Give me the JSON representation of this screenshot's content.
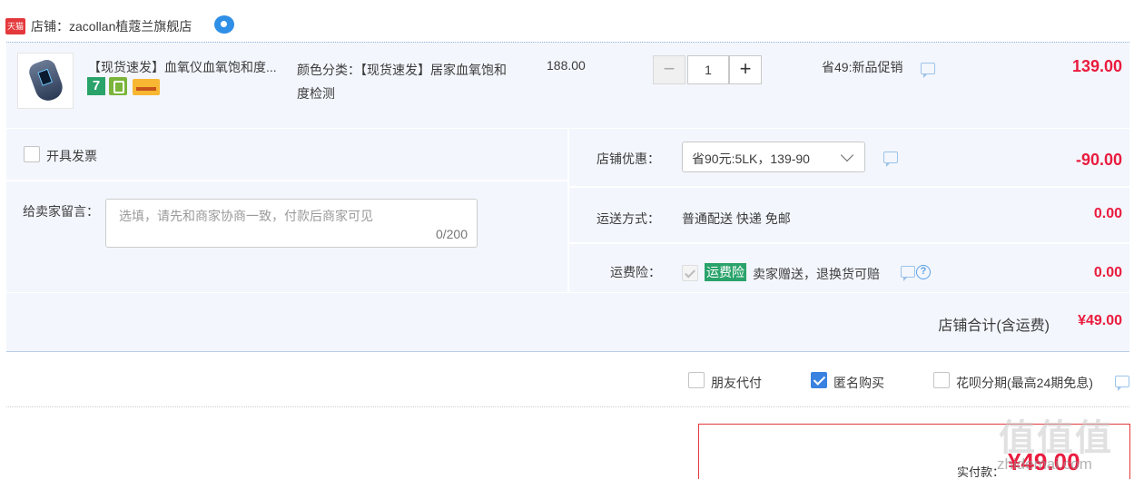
{
  "shop": {
    "logo_text": "天猫",
    "name": "店铺：zacollan植蔻兰旗舰店",
    "chat_icon": "wangwang-chat-icon"
  },
  "item": {
    "title": "【现货速发】血氧仪血氧饱和度...",
    "badges": [
      "7",
      "bag-badge-icon",
      "card-badge-icon"
    ],
    "badge_seven": "7",
    "sku": "颜色分类：【现货速发】居家血氧饱和度检测",
    "unit_price": "188.00",
    "qty_minus": "−",
    "quantity": "1",
    "qty_plus": "+",
    "promo": "省49:新品促销",
    "subtotal": "139.00"
  },
  "invoice": {
    "label": "开具发票",
    "checked": false
  },
  "note": {
    "label": "给卖家留言：",
    "placeholder": "选填，请先和商家协商一致，付款后商家可见",
    "count": "0/200"
  },
  "coupon": {
    "label": "店铺优惠：",
    "selected": "省90元:5LK，139-90",
    "value": "-90.00"
  },
  "shipping": {
    "label": "运送方式：",
    "method": "普通配送 快递 免邮",
    "value": "0.00"
  },
  "insurance": {
    "label": "运费险：",
    "tag": "运费险",
    "text": "卖家赠送，退换货可赔",
    "help": "?",
    "value": "0.00"
  },
  "total": {
    "label": "店铺合计(含运费)",
    "value": "¥49.00"
  },
  "payment_options": {
    "friend_pay": {
      "label": "朋友代付",
      "checked": false
    },
    "anonymous": {
      "label": "匿名购买",
      "checked": true
    },
    "huabei": {
      "label": "花呗分期(最高24期免息)",
      "checked": false
    }
  },
  "summary": {
    "label": "实付款：",
    "value": "¥49.00"
  },
  "watermark": {
    "logo": "值值值",
    "site": "zhidemai.com"
  },
  "colors": {
    "accent_red": "#ea1b3e",
    "row_bg": "#f3f6fc",
    "check_blue": "#3a82e0",
    "green_tag": "#2aa36b"
  }
}
